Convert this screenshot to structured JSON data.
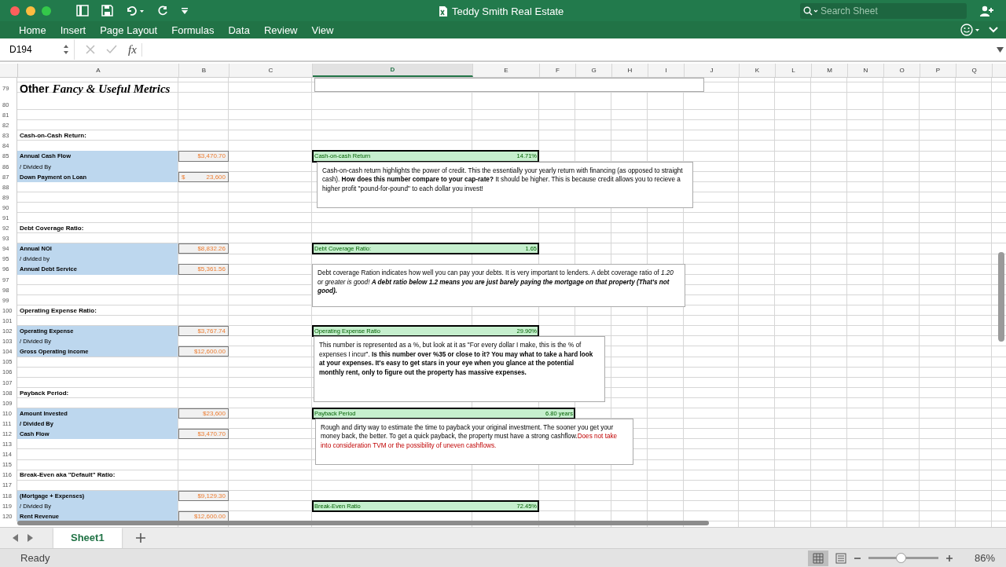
{
  "window": {
    "title": "Teddy Smith Real Estate"
  },
  "search": {
    "placeholder": "Search Sheet"
  },
  "ribbon_tabs": [
    {
      "label": "Home",
      "selected": false
    },
    {
      "label": "Insert",
      "selected": false
    },
    {
      "label": "Page Layout",
      "selected": false
    },
    {
      "label": "Formulas",
      "selected": false
    },
    {
      "label": "Data",
      "selected": false
    },
    {
      "label": "Review",
      "selected": false
    },
    {
      "label": "View",
      "selected": false
    }
  ],
  "formula_bar": {
    "name_box": "D194",
    "fx": "fx"
  },
  "columns": [
    {
      "label": "A",
      "selected": false
    },
    {
      "label": "B",
      "selected": false
    },
    {
      "label": "C",
      "selected": false
    },
    {
      "label": "D",
      "selected": true
    },
    {
      "label": "E",
      "selected": false
    },
    {
      "label": "F",
      "selected": false
    },
    {
      "label": "G",
      "selected": false
    },
    {
      "label": "H",
      "selected": false
    },
    {
      "label": "I",
      "selected": false
    },
    {
      "label": "J",
      "selected": false
    },
    {
      "label": "K",
      "selected": false
    },
    {
      "label": "L",
      "selected": false
    },
    {
      "label": "M",
      "selected": false
    },
    {
      "label": "N",
      "selected": false
    },
    {
      "label": "O",
      "selected": false
    },
    {
      "label": "P",
      "selected": false
    },
    {
      "label": "Q",
      "selected": false
    }
  ],
  "rows": [
    {
      "n": "79",
      "kind": "title",
      "lead": "Other",
      "script": "Fancy & Useful Metrics"
    },
    {
      "n": "80"
    },
    {
      "n": "81"
    },
    {
      "n": "82"
    },
    {
      "n": "83",
      "kind": "heading",
      "label": "Cash-on-Cash Return:"
    },
    {
      "n": "84"
    },
    {
      "n": "85",
      "kind": "input",
      "bold": true,
      "label": "Annual Cash Flow",
      "value": "$3,470.70",
      "result": {
        "label": "Cash-on-cash Return",
        "value": "14.71%",
        "wide": false
      }
    },
    {
      "n": "86",
      "kind": "input",
      "bold": false,
      "label": "/ Divided By",
      "comment": {
        "text": "Cash-on-cash return highlights the power of credit. This the essentially your yearly return with financing (as opposed to straight cash). **How does this number compare to your cap-rate?** It should be higher. This is because credit allows you to recieve a higher profit \"pound-for-pound\" to each dollar you invest!"
      }
    },
    {
      "n": "87",
      "kind": "input",
      "bold": true,
      "label": "Down Payment on Loan",
      "prefix": "$",
      "value": "23,600"
    },
    {
      "n": "88"
    },
    {
      "n": "89"
    },
    {
      "n": "90"
    },
    {
      "n": "91"
    },
    {
      "n": "92",
      "kind": "heading",
      "label": "Debt Coverage Ratio:"
    },
    {
      "n": "93"
    },
    {
      "n": "94",
      "kind": "input",
      "bold": true,
      "label": "Annual NOI",
      "value": "$8,832.26",
      "result": {
        "label": "Debt Coverage Ratio:",
        "value": "1.65",
        "wide": false
      }
    },
    {
      "n": "95",
      "kind": "input",
      "bold": false,
      "label": "/ divided by"
    },
    {
      "n": "96",
      "kind": "input",
      "bold": true,
      "label": "Annual Debt Service",
      "value": "$5,361.56",
      "comment": {
        "text": "Debt coverage Ration indicates how well you can pay your debts. It is very important to lenders. A debt coverage ratio of *1.20 or greater is good!* **A debt ratio below 1.2 means you are just barely paying the mortgage on that property (That's not good).**",
        "bold_italic": true
      }
    },
    {
      "n": "97"
    },
    {
      "n": "98"
    },
    {
      "n": "99"
    },
    {
      "n": "100",
      "kind": "heading",
      "label": "Operating Expense Ratio:"
    },
    {
      "n": "101"
    },
    {
      "n": "102",
      "kind": "input",
      "bold": true,
      "label": "Operating Expense",
      "value": "$3,767.74",
      "result": {
        "label": "Operating Expense Ratio",
        "value": "29.90%",
        "wide": false
      }
    },
    {
      "n": "103",
      "kind": "input",
      "bold": false,
      "label": "/ Divided By",
      "comment": {
        "text": "This number is represented as a %, but look at it as \"For every dollar I make, this is the % of expenses I incur\". **Is this number over %35 or close to it? You may what to take a hard look at your expenses. It's easy to get stars in your eye when you glance at the potential monthly rent, only to figure out the property has massive expenses.**"
      }
    },
    {
      "n": "104",
      "kind": "input",
      "bold": true,
      "label": "Gross Operating income",
      "value": "$12,600.00"
    },
    {
      "n": "105"
    },
    {
      "n": "106"
    },
    {
      "n": "107"
    },
    {
      "n": "108",
      "kind": "heading",
      "label": "Payback Period:"
    },
    {
      "n": "109"
    },
    {
      "n": "110",
      "kind": "input",
      "bold": true,
      "label": "Amount Invested",
      "value": "$23,600",
      "result": {
        "label": "Payback Period",
        "value": "6.80 years",
        "wide": true
      }
    },
    {
      "n": "111",
      "kind": "input",
      "bold": true,
      "label": "/ Divided By",
      "comment": {
        "text": "Rough and dirty way to estimate the time to payback your original investment. The sooner you get your money back, the better. To get a quick payback, the property must have a strong cashflow.",
        "warning": "Does not take into consideration TVM or the possibility of uneven cashflows."
      }
    },
    {
      "n": "112",
      "kind": "input",
      "bold": true,
      "label": "Cash Flow",
      "value": "$3,470.70"
    },
    {
      "n": "113"
    },
    {
      "n": "114"
    },
    {
      "n": "115"
    },
    {
      "n": "116",
      "kind": "heading",
      "label": "Break-Even aka \"Default\" Ratio:"
    },
    {
      "n": "117"
    },
    {
      "n": "118",
      "kind": "input",
      "bold": true,
      "label": "(Mortgage + Expenses)",
      "value": "$9,129.30"
    },
    {
      "n": "119",
      "kind": "input",
      "bold": false,
      "label": "/ Divided By",
      "result": {
        "label": "Break-Even Ratio",
        "value": "72.45%",
        "wide": false
      }
    },
    {
      "n": "120",
      "kind": "input",
      "bold": true,
      "label": "Rent Revenue",
      "value": "$12,600.00"
    }
  ],
  "sheet_tabs": [
    {
      "label": "Sheet1",
      "selected": true
    }
  ],
  "status_bar": {
    "text": "Ready",
    "zoom": {
      "level": 0.47,
      "reading": "86%"
    }
  }
}
